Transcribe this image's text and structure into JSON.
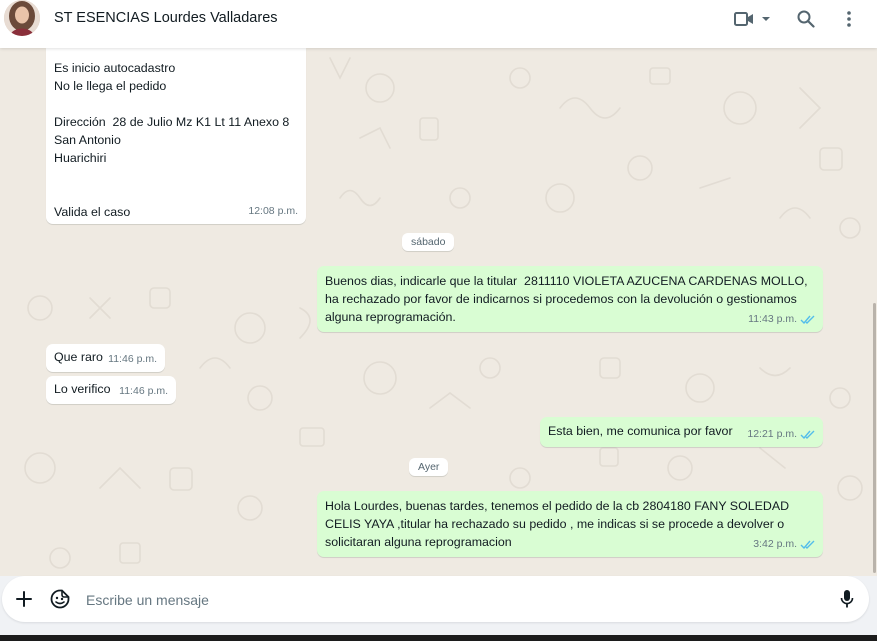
{
  "header": {
    "contact_name": "ST ESENCIAS Lourdes Valladares",
    "icons": [
      "video-call-icon",
      "chevron-down-icon",
      "search-icon",
      "more-vertical-icon"
    ]
  },
  "messages": [
    {
      "direction": "incoming",
      "text": "Es inicio autocadastro\nNo le llega el pedido\n\nDirección  28 de Julio Mz K1 Lt 11 Anexo 8\nSan Antonio\nHuarichiri\n\n\nValida el caso",
      "time": "12:08 p.m."
    },
    {
      "type": "day",
      "label": "sábado"
    },
    {
      "direction": "outgoing",
      "text": "Buenos dias, indicarle que la titular  2811110 VIOLETA AZUCENA CARDENAS MOLLO, ha rechazado por favor de indicarnos si procedemos con la devolución o gestionamos alguna reprogramación.",
      "time": "11:43 p.m."
    },
    {
      "direction": "incoming",
      "text": "Que raro",
      "time": "11:46 p.m."
    },
    {
      "direction": "incoming",
      "text": "Lo verifico",
      "time": "11:46 p.m."
    },
    {
      "direction": "outgoing",
      "text": "Esta bien, me comunica por favor",
      "time": "12:21 p.m."
    },
    {
      "type": "day",
      "label": "Ayer"
    },
    {
      "direction": "outgoing",
      "text": "Hola Lourdes, buenas tardes, tenemos el pedido de la cb 2804180 FANY SOLEDAD CELIS YAYA ,titular ha rechazado su pedido , me indicas si se procede a devolver o solicitaran alguna reprogramacion",
      "time": "3:42 p.m."
    }
  ],
  "composer": {
    "placeholder": "Escribe un mensaje",
    "value": "",
    "icons": [
      "plus-icon",
      "sticker-icon",
      "microphone-icon"
    ]
  },
  "colors": {
    "chat_background": "#efeae2",
    "outgoing_bubble": "#d9fdd3",
    "incoming_bubble": "#ffffff",
    "read_ticks": "#53bdeb"
  }
}
